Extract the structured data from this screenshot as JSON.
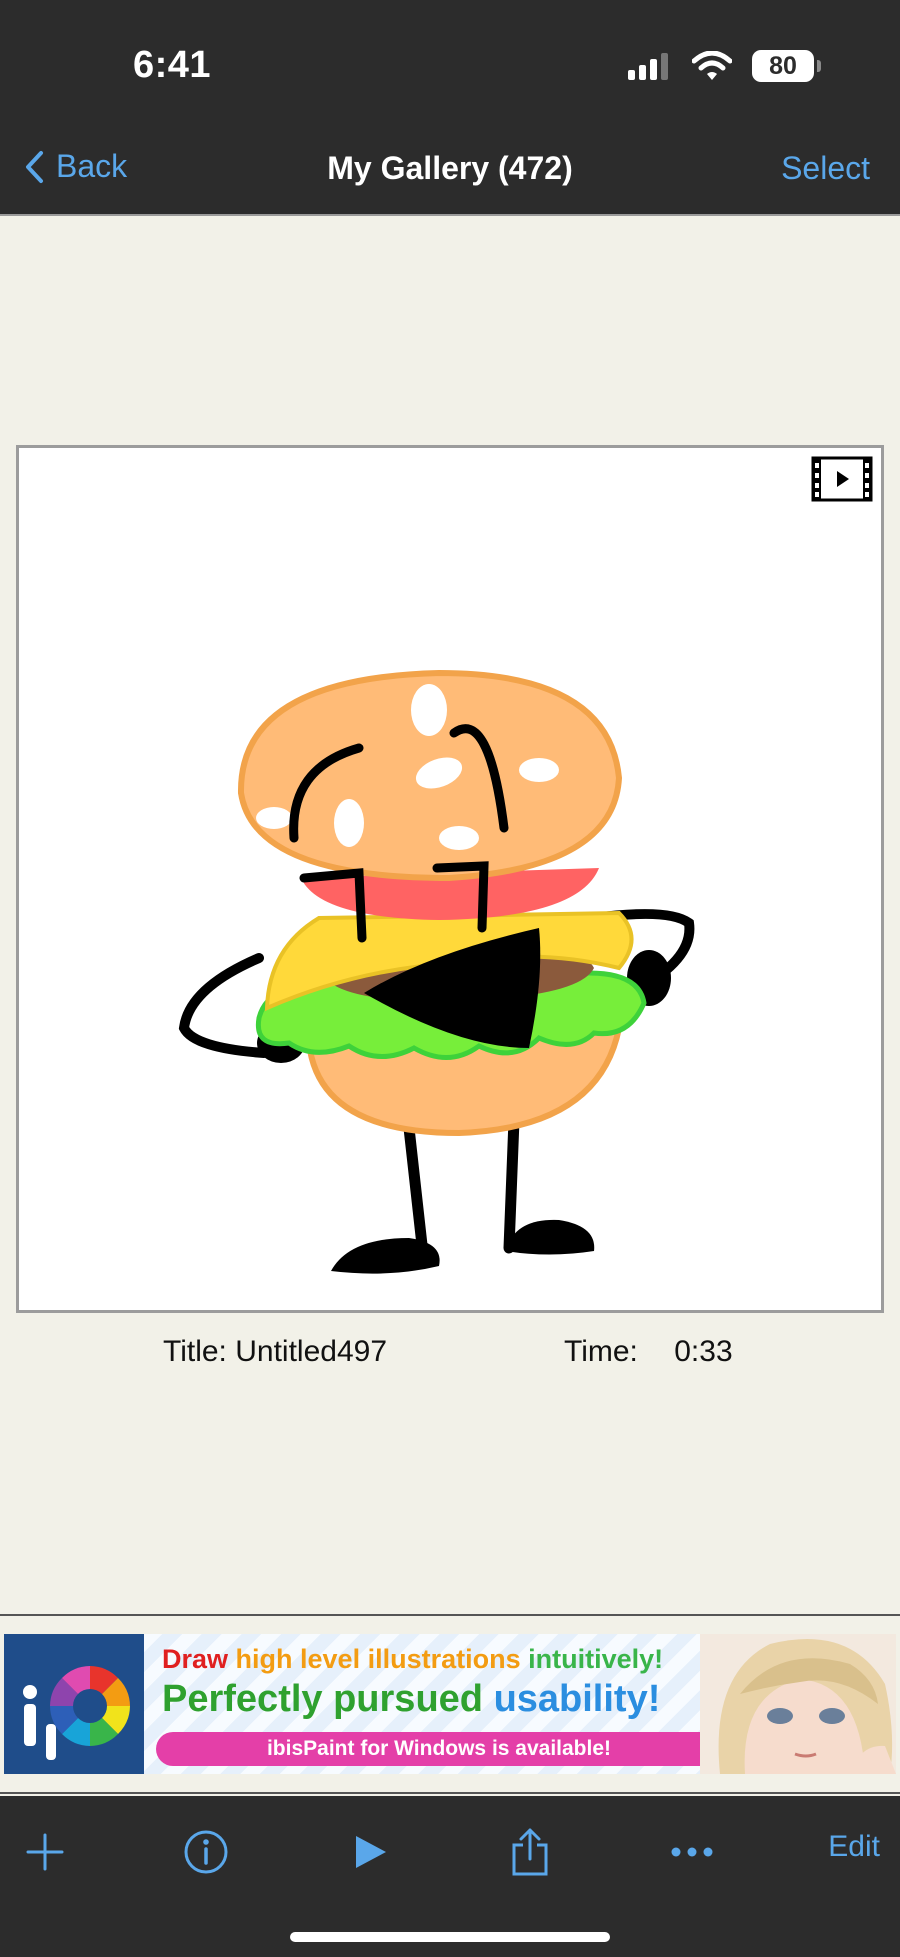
{
  "status_bar": {
    "time": "6:41",
    "battery": "80",
    "icons": [
      "signal-icon",
      "wifi-icon",
      "battery-icon"
    ]
  },
  "nav": {
    "back_label": "Back",
    "title": "My Gallery (472)",
    "select_label": "Select"
  },
  "artwork": {
    "movie_icon": "movie-play-icon",
    "title_label": "Title:",
    "title_value": "Untitled497",
    "time_label": "Time:",
    "time_value": "0:33"
  },
  "ad": {
    "line1": [
      "Draw",
      "high level illustrations",
      "intuitively!"
    ],
    "line2": [
      "Perfectly pursued",
      "usability!"
    ],
    "pill_text": "ibisPaint for Windows is available!",
    "logo_icon": "ibispaint-logo-icon"
  },
  "toolbar": {
    "icons": [
      "plus-icon",
      "info-icon",
      "play-icon",
      "share-icon",
      "more-icon"
    ],
    "edit_label": "Edit"
  },
  "colors": {
    "accent": "#5aa7ea",
    "bar_background": "#2c2c2c",
    "page_background": "#f2f1e8"
  }
}
